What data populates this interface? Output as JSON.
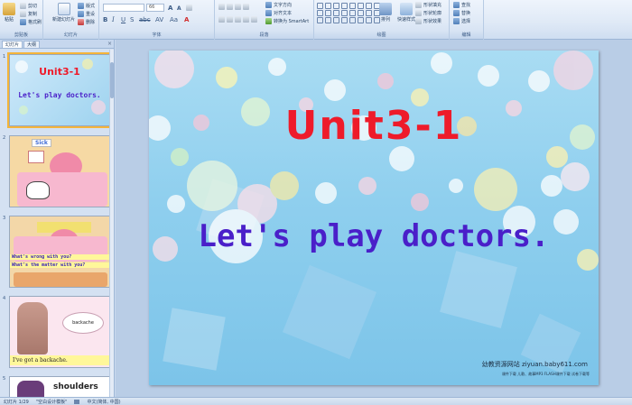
{
  "ribbon": {
    "clipboard": {
      "paste": "粘贴",
      "cut": "剪切",
      "copy": "复制",
      "format_painter": "格式刷",
      "label": "剪贴板"
    },
    "slides": {
      "new_slide": "新建幻灯片",
      "layout": "版式",
      "reset": "重设",
      "delete": "删除",
      "label": "幻灯片"
    },
    "font": {
      "font_name": "",
      "font_size": "66",
      "label": "字体"
    },
    "paragraph": {
      "text_direction": "文字方向",
      "align_text": "对齐文本",
      "smartart": "转换为 SmartArt",
      "label": "段落"
    },
    "drawing": {
      "arrange": "排列",
      "quick_styles": "快速样式",
      "shape_fill": "形状填充",
      "shape_outline": "形状轮廓",
      "shape_effects": "形状效果",
      "label": "绘图"
    },
    "editing": {
      "find": "查找",
      "replace": "替换",
      "select": "选择",
      "label": "编辑"
    }
  },
  "left_panel": {
    "tabs": [
      "幻灯片",
      "大纲"
    ],
    "close": "×",
    "thumbnails": [
      {
        "num": "1",
        "title": "Unit3-1",
        "subtitle": "Let's play doctors."
      },
      {
        "num": "2",
        "badge": "Sick"
      },
      {
        "num": "3",
        "line1": "What's wrong with you?",
        "line2": "What's the matter with you?"
      },
      {
        "num": "4",
        "bubble": "backache",
        "caption": "I've got a backache."
      },
      {
        "num": "5",
        "text": "shoulders"
      }
    ]
  },
  "slide": {
    "title": "Unit3-1",
    "subtitle": "Let's play doctors.",
    "watermark": "幼教资源网站  ziyuan.baby611.com",
    "watermark_sub": "课件下载    儿歌、故事MP3    FLASH课件下载    试卷下载等"
  },
  "status_bar": {
    "slide_info": "幻灯片 1/29",
    "theme": "\"空白设计模板\"",
    "language": "中文(简体, 中国)"
  }
}
